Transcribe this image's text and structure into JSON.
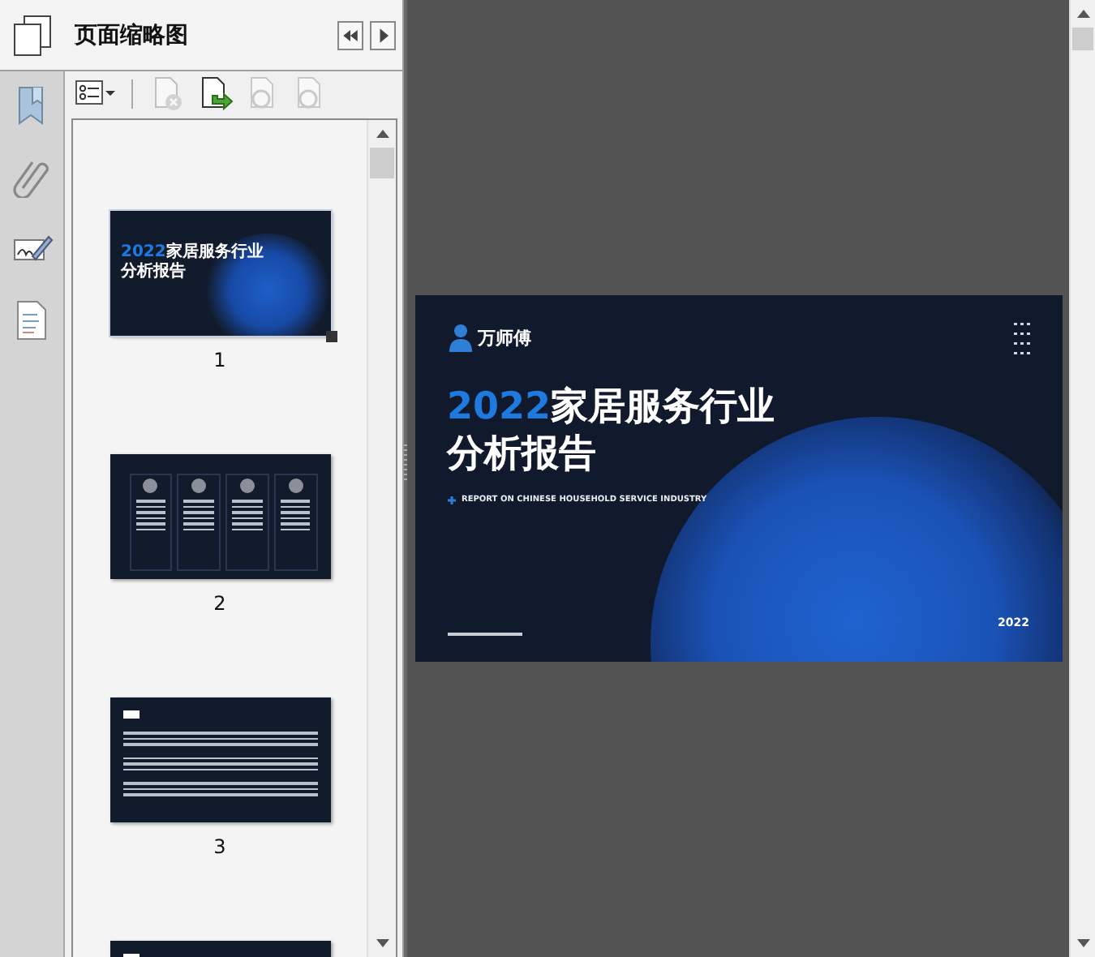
{
  "panel": {
    "title": "页面缩略图",
    "nav_buttons": [
      {
        "kind": "back"
      },
      {
        "kind": "forward"
      }
    ]
  },
  "rail": [
    {
      "kind": "bookmark"
    },
    {
      "kind": "attachment"
    },
    {
      "kind": "signature"
    },
    {
      "kind": "document"
    }
  ],
  "toolbar": [
    {
      "kind": "options",
      "disabled": false
    },
    {
      "kind": "delete",
      "disabled": true
    },
    {
      "kind": "insert",
      "disabled": false
    },
    {
      "kind": "pageaction",
      "disabled": true
    },
    {
      "kind": "pageaction",
      "disabled": true
    }
  ],
  "thumbnails": [
    {
      "kind": "cover",
      "label": "1",
      "selected": true,
      "title_highlight": "2022",
      "title_rest": "家居服务行业",
      "title_line2": "分析报告"
    },
    {
      "kind": "cards",
      "label": "2",
      "selected": false
    },
    {
      "kind": "text",
      "label": "3",
      "selected": false
    },
    {
      "kind": "text",
      "selected": false
    }
  ],
  "document": {
    "logo": "万师傅",
    "title_highlight": "2022",
    "title_rest": "家居服务行业",
    "title_line2": "分析报告",
    "subtitle": "REPORT ON CHINESE HOUSEHOLD SERVICE INDUSTRY",
    "year": "2022"
  }
}
